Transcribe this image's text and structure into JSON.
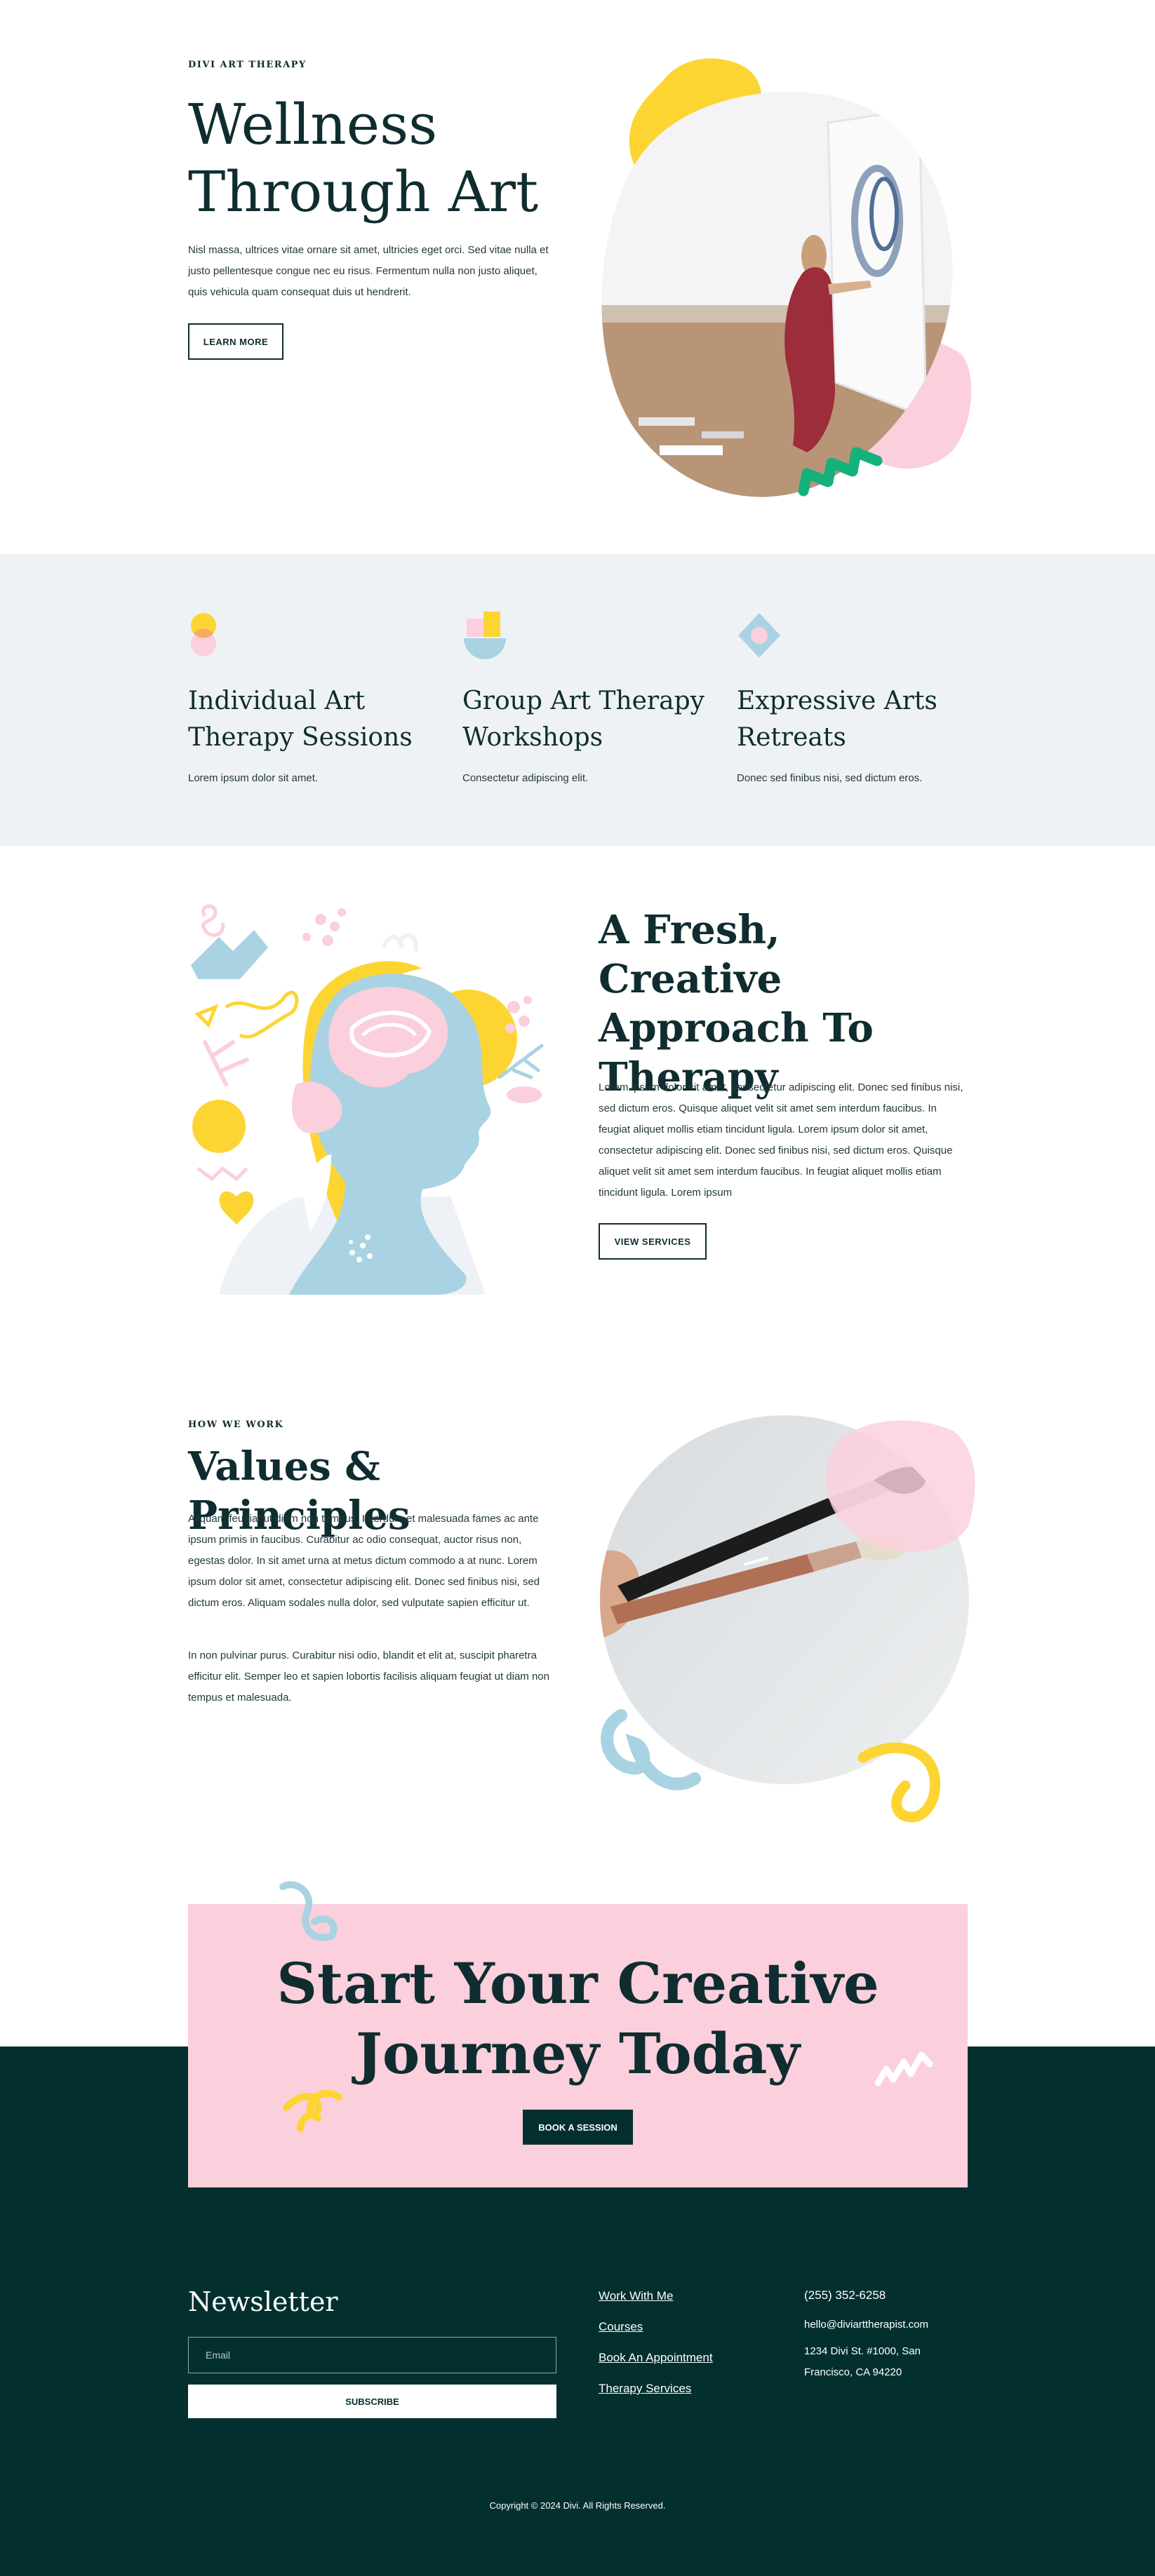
{
  "hero": {
    "eyebrow": "DIVI ART THERAPY",
    "title_line1": "Wellness",
    "title_line2": "Through Art",
    "body": "Nisl massa, ultrices vitae ornare sit amet, ultricies eget orci. Sed vitae nulla et justo pellentesque congue nec eu risus. Fermentum nulla non justo aliquet, quis vehicula quam consequat duis ut hendrerit.",
    "button": "LEARN MORE"
  },
  "services": [
    {
      "title_line1": "Individual Art",
      "title_line2": "Therapy Sessions",
      "text": "Lorem ipsum dolor sit amet."
    },
    {
      "title_line1": "Group Art Therapy",
      "title_line2": "Workshops",
      "text": "Consectetur adipiscing elit."
    },
    {
      "title_line1": "Expressive Arts",
      "title_line2": "Retreats",
      "text": "Donec sed finibus nisi, sed dictum eros."
    }
  ],
  "approach": {
    "title_line1": "A Fresh, Creative",
    "title_line2": "Approach To",
    "title_line3": "Therapy",
    "body": "Lorem ipsum dolor sit amet, consectetur adipiscing elit. Donec sed finibus nisi, sed dictum eros. Quisque aliquet velit sit amet sem interdum faucibus. In feugiat aliquet mollis etiam tincidunt ligula. Lorem ipsum dolor sit amet, consectetur adipiscing elit. Donec sed finibus nisi, sed dictum eros. Quisque aliquet velit sit amet sem interdum faucibus. In feugiat aliquet mollis etiam tincidunt ligula. Lorem ipsum",
    "button": "VIEW SERVICES"
  },
  "values": {
    "eyebrow": "HOW WE WORK",
    "title": "Values & Principles",
    "para1": "Aliquam feugiat ut diam non tempus. Interdum et malesuada fames ac ante ipsum primis in faucibus. Curabitur ac odio consequat, auctor risus non, egestas dolor. In sit amet urna at metus dictum commodo a at nunc. Lorem ipsum dolor sit amet, consectetur adipiscing elit. Donec sed finibus nisi, sed dictum eros. Aliquam sodales nulla dolor, sed vulputate sapien efficitur ut.",
    "para2": "In non pulvinar purus. Curabitur nisi odio, blandit et elit at, suscipit pharetra efficitur elit. Semper leo et sapien lobortis facilisis aliquam feugiat ut diam non tempus et malesuada."
  },
  "cta": {
    "title_line1": "Start Your Creative",
    "title_line2": "Journey Today",
    "button": "BOOK A SESSION"
  },
  "footer": {
    "newsletter_title": "Newsletter",
    "email_placeholder": "Email",
    "subscribe": "SUBSCRIBE",
    "links": [
      "Work With Me",
      "Courses",
      "Book An Appointment",
      "Therapy Services"
    ],
    "phone": "(255) 352-6258",
    "email": "hello@diviarttherapist.com",
    "address_line1": "1234 Divi St. #1000, San",
    "address_line2": "Francisco, CA 94220",
    "copyright": "Copyright © 2024 Divi. All Rights Reserved."
  },
  "colors": {
    "dark_green": "#03302f",
    "pink": "#fbcfdc",
    "yellow": "#fdd533",
    "light_blue": "#a9d3e3",
    "green_accent": "#14b27a",
    "light_gray_bg": "#eff2f5"
  }
}
